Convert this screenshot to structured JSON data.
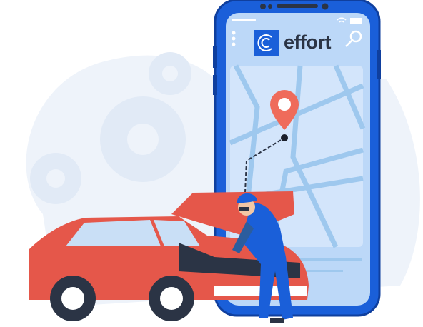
{
  "app": {
    "brand_name": "effort"
  },
  "icons": [
    "menu-dots-icon",
    "effort-logo-icon",
    "search-icon",
    "wifi-icon",
    "battery-icon",
    "map-pin-icon",
    "gear-icon"
  ],
  "colors": {
    "phone_blue": "#1a5fd9",
    "screen": "#bcd8f8",
    "car_red": "#e5574a",
    "pin": "#ef6b5b",
    "background": "#eef3fa"
  }
}
